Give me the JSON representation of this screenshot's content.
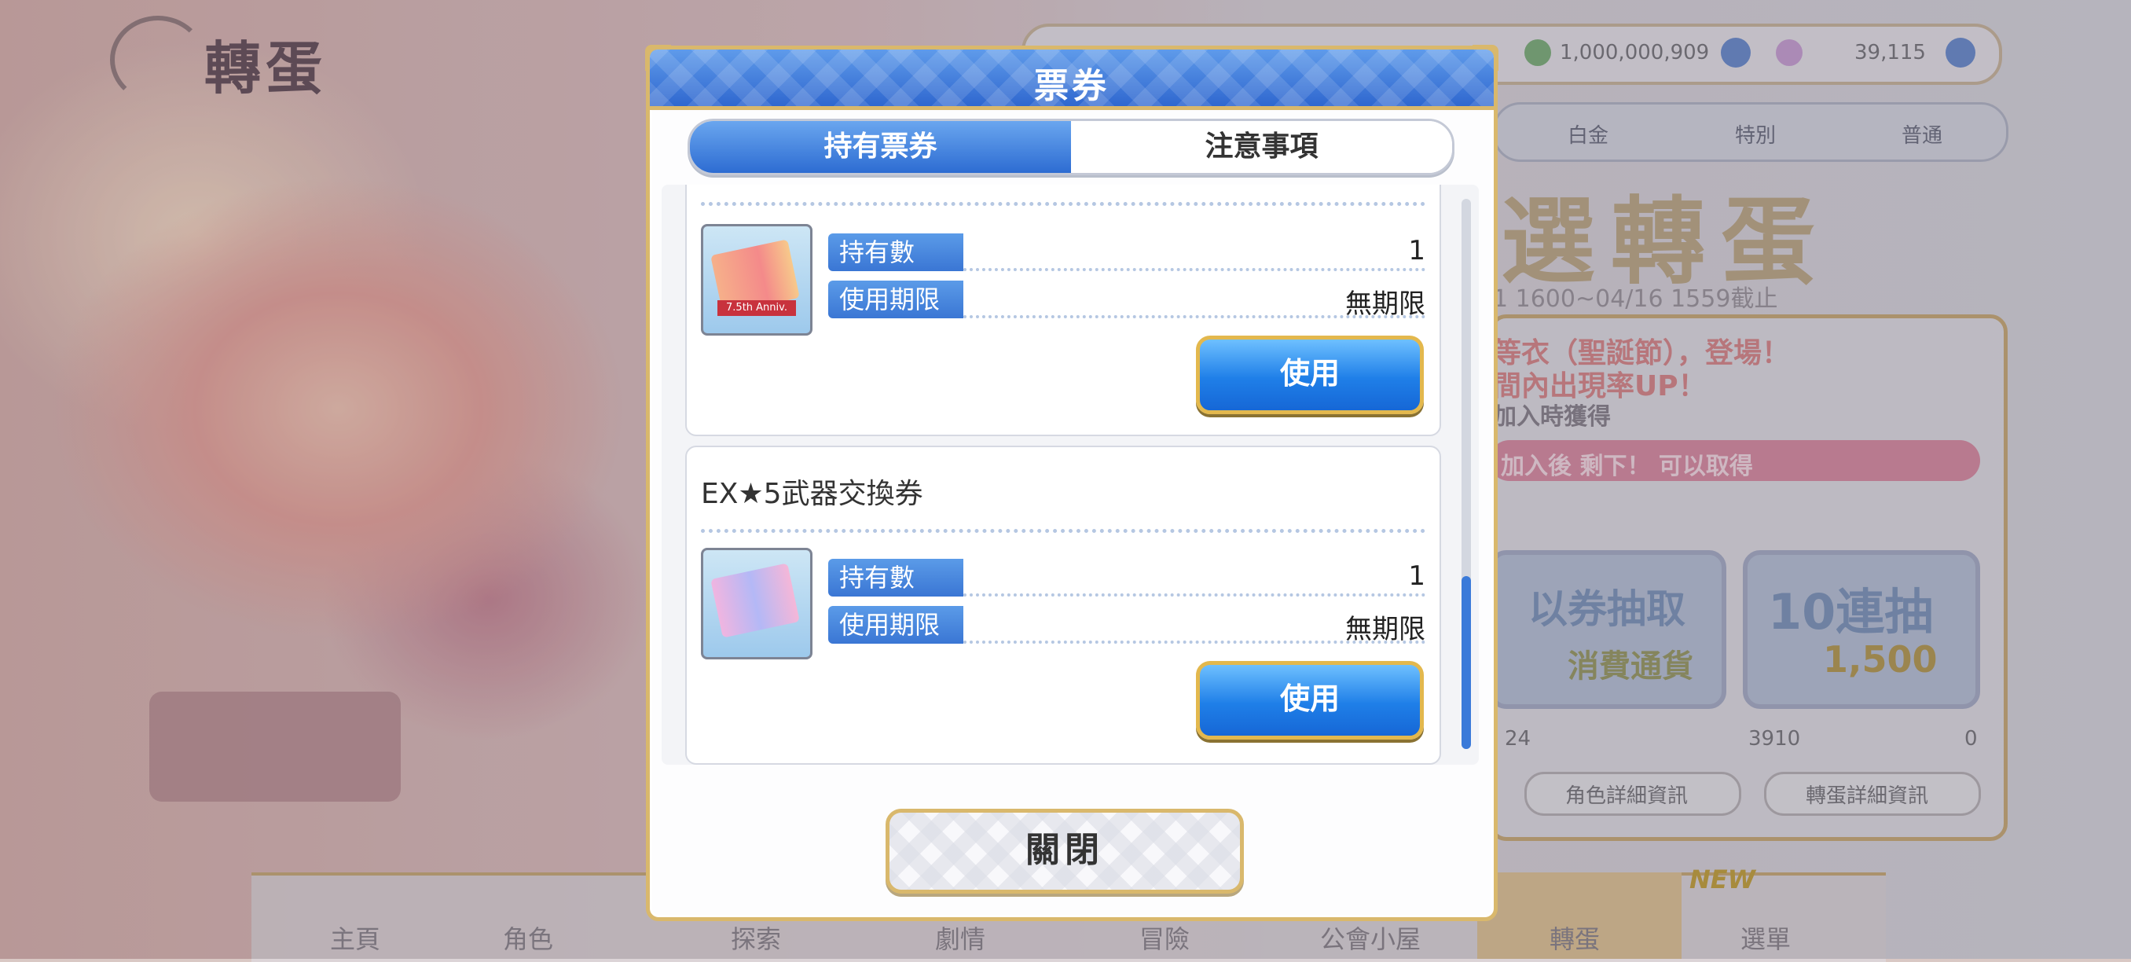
{
  "background": {
    "screen_title": "轉蛋",
    "currency": [
      "1,000,000,909",
      "39,115"
    ],
    "tabs": [
      "白金",
      "特別",
      "普通"
    ],
    "banner_title": "選轉蛋",
    "date_text": "1 1600~04/16 1559截止",
    "red_text_1": "等衣（聖誕節），登場！",
    "red_text_2": "間內出現率UP！",
    "sub_text": "加入時獲得",
    "pink_bar_text": "加入後  剩下！ 可以取得",
    "gacha_single": "以券抽取",
    "gacha_single_sub": "消費通貨",
    "gacha_ten": "10連抽",
    "gacha_ten_cost": "1,500",
    "counts": [
      "24",
      "3910",
      "0"
    ],
    "small_buttons": [
      "角色詳細資訊",
      "轉蛋詳細資訊"
    ],
    "nav": [
      "主頁",
      "角色",
      "探索",
      "劇情",
      "冒險",
      "公會小屋",
      "轉蛋",
      "選單"
    ],
    "new_badge": "NEW"
  },
  "dialog": {
    "title": "票券",
    "tabs": {
      "owned": "持有票券",
      "notes": "注意事項",
      "active": "owned"
    },
    "tickets": [
      {
        "name": "",
        "icon": "anniversary-ticket-icon",
        "icon_text": "7.5th Anniv.",
        "count_label": "持有數",
        "count": "1",
        "expiry_label": "使用期限",
        "expiry": "無期限",
        "use_label": "使用"
      },
      {
        "name": "EX★5武器交換券",
        "icon": "weapon-ticket-icon",
        "count_label": "持有數",
        "count": "1",
        "expiry_label": "使用期限",
        "expiry": "無期限",
        "use_label": "使用"
      }
    ],
    "close_label": "關閉"
  },
  "colors": {
    "header_blue": "#2f67cf",
    "gold_border": "#d9b86c",
    "button_blue": "#1f7fe8",
    "label_blue": "#3a76d4"
  }
}
